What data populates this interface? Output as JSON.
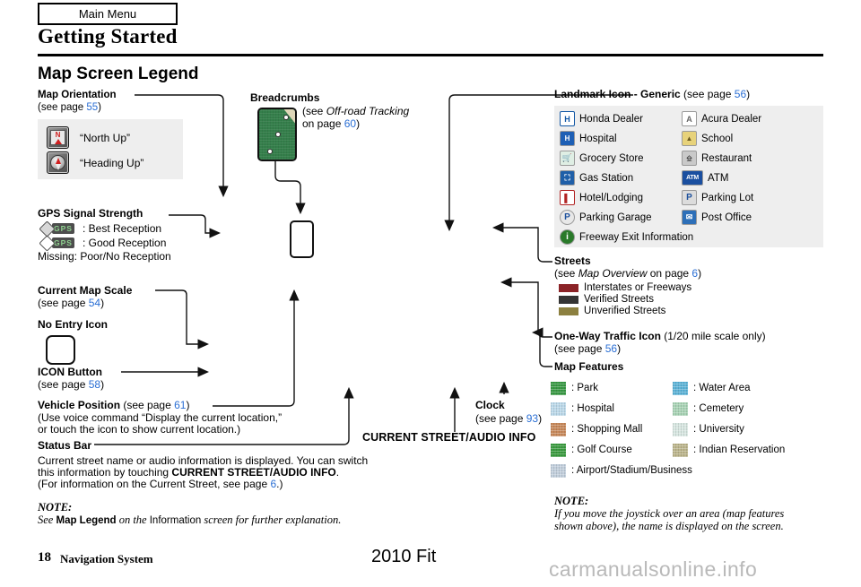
{
  "header": {
    "main_menu": "Main Menu",
    "chapter_title": "Getting Started",
    "section_title": "Map Screen Legend"
  },
  "map_orientation": {
    "title": "Map Orientation",
    "see": "(see page ",
    "page": "55",
    "close": ")",
    "options": [
      {
        "icon": "north-up-icon",
        "label": "“North Up”"
      },
      {
        "icon": "heading-up-icon",
        "label": "“Heading Up”"
      }
    ]
  },
  "gps": {
    "title": "GPS Signal Strength",
    "rows": [
      {
        "icon": "gps-filled-icon",
        "label": ": Best Reception"
      },
      {
        "icon": "gps-hollow-icon",
        "label": ": Good Reception"
      }
    ],
    "missing": "Missing: Poor/No Reception"
  },
  "current_map_scale": {
    "title": "Current Map Scale",
    "see": "(see page ",
    "page": "54",
    "close": ")"
  },
  "no_entry": {
    "title": "No Entry Icon"
  },
  "icon_button": {
    "title": "ICON Button",
    "see": "(see page ",
    "page": "58",
    "close": ")"
  },
  "vehicle_position": {
    "title": "Vehicle Position",
    "see": " (see page ",
    "page": "61",
    "close": ")",
    "line2": "(Use voice command “Display the current location,”",
    "line3": "or touch the icon to show current location.)"
  },
  "status_bar": {
    "title": "Status Bar",
    "line1": "Current street name or audio information is displayed. You can switch",
    "line2_pre": "this information by touching ",
    "line2_bold": "CURRENT STREET/AUDIO INFO",
    "line2_post": ".",
    "line3_pre": "(For information on the Current Street, see page ",
    "line3_page": "6",
    "line3_post": ".)"
  },
  "note_left": {
    "title": "NOTE:",
    "pre": "See ",
    "bold1": "Map Legend",
    "mid1": " on the ",
    "plain1": "Information",
    "mid2": " screen for further explanation."
  },
  "breadcrumbs": {
    "title": "Breadcrumbs",
    "see_pre": "(see ",
    "see_italic": "Off-road Tracking",
    "line2_pre": "on page ",
    "page": "60",
    "close": ")"
  },
  "current_street": {
    "label": "CURRENT STREET/AUDIO INFO"
  },
  "clock": {
    "title": "Clock",
    "see": "(see page ",
    "page": "93",
    "close": ")"
  },
  "landmark": {
    "title": "Landmark Icon - Generic",
    "see": " (see page ",
    "page": "56",
    "close": ")",
    "items": [
      {
        "icon": "honda-dealer-icon",
        "glyph": "H",
        "cls": "ico-honda",
        "label": "Honda Dealer"
      },
      {
        "icon": "acura-dealer-icon",
        "glyph": "A",
        "cls": "ico-acura",
        "label": "Acura Dealer"
      },
      {
        "icon": "hospital-icon",
        "glyph": "H",
        "cls": "ico-hospital",
        "label": "Hospital"
      },
      {
        "icon": "school-icon",
        "glyph": "◢",
        "cls": "ico-school",
        "label": "School"
      },
      {
        "icon": "grocery-store-icon",
        "glyph": "Ὥ2",
        "cls": "ico-grocery",
        "label": "Grocery Store"
      },
      {
        "icon": "restaurant-icon",
        "glyph": "‖",
        "cls": "ico-restaurant",
        "label": "Restaurant"
      },
      {
        "icon": "gas-station-icon",
        "glyph": "⛽",
        "cls": "ico-gas",
        "label": "Gas Station"
      },
      {
        "icon": "atm-icon",
        "glyph": "ATM",
        "cls": "ico-atm",
        "label": "ATM"
      },
      {
        "icon": "hotel-lodging-icon",
        "glyph": "▄",
        "cls": "ico-hotel",
        "label": "Hotel/Lodging"
      },
      {
        "icon": "parking-lot-icon",
        "glyph": "P",
        "cls": "ico-parkinglot",
        "label": "Parking Lot"
      },
      {
        "icon": "parking-garage-icon",
        "glyph": "P",
        "cls": "ico-parkinggarage",
        "label": "Parking Garage"
      },
      {
        "icon": "post-office-icon",
        "glyph": "✉",
        "cls": "ico-postoffice",
        "label": "Post Office"
      },
      {
        "icon": "freeway-exit-info-icon",
        "glyph": "i",
        "cls": "ico-freeway",
        "label": "Freeway Exit Information"
      }
    ]
  },
  "streets": {
    "title": "Streets",
    "see_pre": "(see ",
    "see_italic": "Map Overview",
    "see_mid": " on page ",
    "page": "6",
    "close": ")",
    "rows": [
      {
        "color": "#8B2327",
        "label": "Interstates or Freeways"
      },
      {
        "color": "#343434",
        "label": "Verified Streets"
      },
      {
        "color": "#8C8040",
        "label": "Unverified Streets"
      }
    ]
  },
  "one_way": {
    "title": "One-Way Traffic Icon",
    "note": " (1/20 mile scale only)",
    "see": "(see page ",
    "page": "56",
    "close": ")"
  },
  "map_features": {
    "title": "Map Features",
    "items": [
      {
        "color": "#3a9a45",
        "label": ": Park"
      },
      {
        "color": "#5eb4d8",
        "label": ": Water Area"
      },
      {
        "color": "#bcd9ea",
        "label": ": Hospital"
      },
      {
        "color": "#a9d4b6",
        "label": ": Cemetery"
      },
      {
        "color": "#c88a5c",
        "label": ": Shopping Mall"
      },
      {
        "color": "#d8e7e2",
        "label": ": University"
      },
      {
        "color": "#3c9c41",
        "label": ": Golf Course"
      },
      {
        "color": "#bcb58c",
        "label": ": Indian Reservation"
      },
      {
        "color": "#c2cfdc",
        "label": ": Airport/Stadium/Business"
      }
    ]
  },
  "note_right": {
    "title": "NOTE:",
    "line1": "If you move the joystick over an area (map features",
    "line2": "shown above), the name is displayed on the screen."
  },
  "footer": {
    "page_number": "18",
    "doc_title": "Navigation System",
    "model": "2010 Fit",
    "watermark": "carmanualsonline.info"
  },
  "colors": {
    "page_ref": "#2b6fd4",
    "panel_bg": "#eeeeee"
  }
}
